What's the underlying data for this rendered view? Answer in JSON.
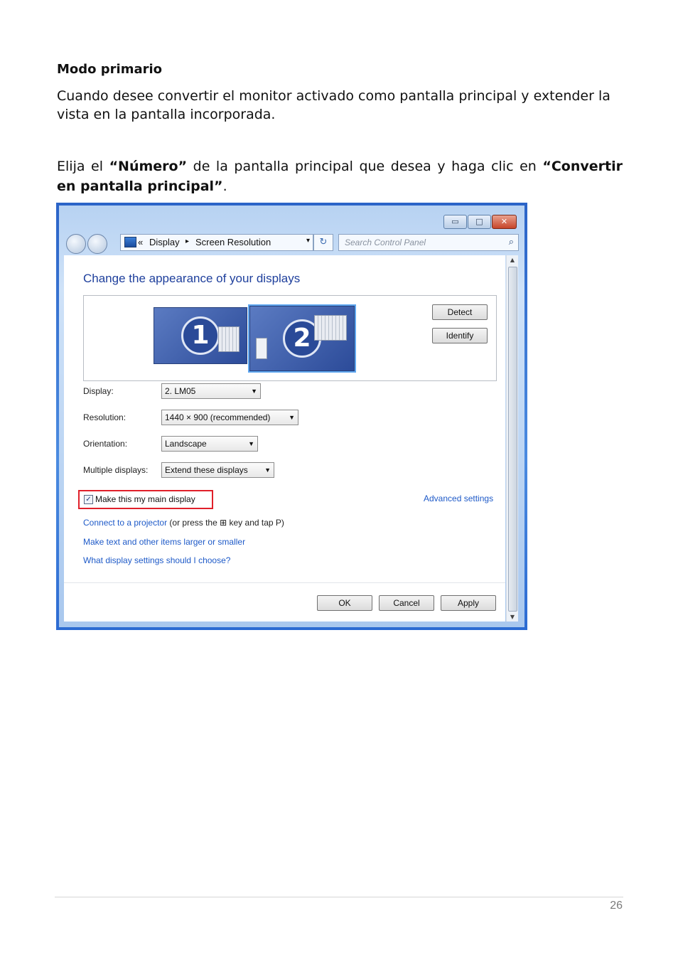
{
  "doc": {
    "heading": "Modo primario",
    "para1": "Cuando desee convertir el monitor activado como pantalla principal y extender la vista en la pantalla incorporada.",
    "para2": {
      "t1": "Elija el ",
      "b1": "“Número”",
      "t2": " de la pantalla principal que desea y haga clic en ",
      "b2": "“Convertir en pantalla principal”",
      "t3": "."
    },
    "page_number": "26"
  },
  "window": {
    "controls": {
      "minimize": "▭",
      "maximize": "□",
      "close": "✕"
    },
    "address": {
      "chevrons": "«",
      "crumb1": "Display",
      "arrow": "▸",
      "crumb2": "Screen Resolution",
      "dropdown": "▾",
      "refresh": "↻"
    },
    "search": {
      "placeholder": "Search Control Panel",
      "icon": "⌕"
    },
    "title": "Change the appearance of your displays",
    "monitors": [
      {
        "number": "1"
      },
      {
        "number": "2"
      }
    ],
    "buttons": {
      "detect": "Detect",
      "identify": "Identify",
      "ok": "OK",
      "cancel": "Cancel",
      "apply": "Apply"
    },
    "fields": {
      "display": {
        "label": "Display:",
        "value": "2. LM05"
      },
      "resolution": {
        "label": "Resolution:",
        "value": "1440 × 900 (recommended)"
      },
      "orientation": {
        "label": "Orientation:",
        "value": "Landscape"
      },
      "multiple": {
        "label": "Multiple displays:",
        "value": "Extend these displays"
      }
    },
    "checkbox": {
      "label": "Make this my main display",
      "checked_mark": "✓"
    },
    "links": {
      "advanced": "Advanced settings",
      "projector": "Connect to a projector",
      "projector_rest_a": " (or press the ",
      "winkey": "⊞",
      "projector_rest_b": " key and tap P)",
      "text_size": "Make text and other items larger or smaller",
      "help": "What display settings should I choose?"
    },
    "scroll": {
      "up": "▲",
      "down": "▼"
    }
  }
}
